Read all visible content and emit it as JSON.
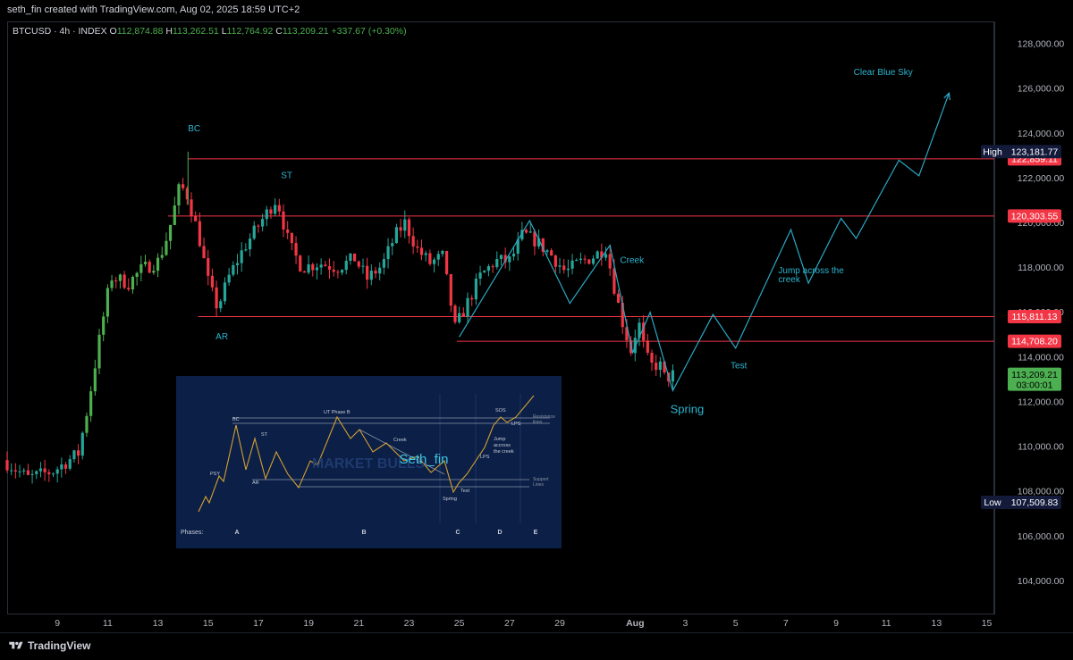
{
  "header": {
    "attribution": "seth_fin created with TradingView.com, Aug 02, 2025 18:59 UTC+2"
  },
  "legend": {
    "symbol": "BTCUSD · 4h · INDEX",
    "open_label": "O",
    "open": "112,874.88",
    "high_label": "H",
    "high": "113,262.51",
    "low_label": "L",
    "low": "112,764.92",
    "close_label": "C",
    "close": "113,209.21",
    "change": "+337.67 (+0.30%)"
  },
  "footer": {
    "brand": "TradingView"
  },
  "colors": {
    "up": "#26a69a",
    "up_bright": "#4caf50",
    "down": "#f23645",
    "level_line": "#f23645",
    "projection": "#2aa8c4",
    "annotation": "#2bb5d0"
  },
  "chart_data": {
    "type": "candlestick",
    "symbol": "BTCUSD",
    "timeframe": "4h",
    "ylim": [
      102500,
      129000
    ],
    "y_ticks": [
      "104,000.00",
      "106,000.00",
      "108,000.00",
      "110,000.00",
      "112,000.00",
      "114,000.00",
      "116,000.00",
      "118,000.00",
      "120,000.00",
      "122,000.00",
      "124,000.00",
      "126,000.00",
      "128,000.00"
    ],
    "x_ticks": [
      "9",
      "11",
      "13",
      "15",
      "17",
      "19",
      "21",
      "23",
      "25",
      "27",
      "29",
      "Aug",
      "3",
      "5",
      "7",
      "9",
      "11",
      "13",
      "15"
    ],
    "x_tick_days": [
      9,
      11,
      13,
      15,
      17,
      19,
      21,
      23,
      25,
      27,
      29,
      32,
      34,
      36,
      38,
      40,
      42,
      44,
      46
    ],
    "x_range_days": [
      7.0,
      46.3
    ],
    "horizontal_levels": [
      {
        "price": 122859.11,
        "label": "122,859.11",
        "from_day": 14.2
      },
      {
        "price": 120303.55,
        "label": "120,303.55",
        "from_day": 13.4
      },
      {
        "price": 115811.13,
        "label": "115,811.13",
        "from_day": 14.6
      },
      {
        "price": 114708.2,
        "label": "114,708.20",
        "from_day": 24.9
      }
    ],
    "price_markers": [
      {
        "kind": "High",
        "price": 123181.77,
        "label": "123,181.77"
      },
      {
        "kind": "Low",
        "price": 107509.83,
        "label": "107,509.83"
      },
      {
        "kind": "Last",
        "price": 113209.21,
        "label": "113,209.21",
        "countdown": "03:00:01"
      }
    ],
    "annotations": [
      {
        "text": "BC",
        "day": 14.2,
        "price": 124100
      },
      {
        "text": "ST",
        "day": 17.9,
        "price": 122000
      },
      {
        "text": "AR",
        "day": 15.3,
        "price": 114800
      },
      {
        "text": "Creek",
        "day": 31.4,
        "price": 118200
      },
      {
        "text": "Jump across the",
        "day": 37.7,
        "price": 117750
      },
      {
        "text": "creek",
        "day": 37.7,
        "price": 117350
      },
      {
        "text": "Test",
        "day": 35.8,
        "price": 113500
      },
      {
        "text": "Spring",
        "day": 33.4,
        "price": 111500
      },
      {
        "text": "Clear Blue Sky",
        "day": 40.7,
        "price": 126600
      }
    ],
    "projection_path": [
      [
        25.0,
        114900
      ],
      [
        27.8,
        120100
      ],
      [
        29.4,
        116400
      ],
      [
        31.0,
        119000
      ],
      [
        31.9,
        114200
      ],
      [
        32.6,
        116000
      ],
      [
        33.5,
        112500
      ],
      [
        35.1,
        115900
      ],
      [
        36.0,
        114400
      ],
      [
        38.2,
        119700
      ],
      [
        38.9,
        117300
      ],
      [
        40.2,
        120200
      ],
      [
        40.8,
        119300
      ],
      [
        42.5,
        122800
      ],
      [
        43.3,
        122100
      ],
      [
        44.5,
        125800
      ]
    ],
    "wyckoff_inset": {
      "title": "Seth_fin",
      "watermark": "MARKET BULLS",
      "labels": [
        "PSY",
        "BC",
        "ST",
        "AR",
        "UT Phase B",
        "Creek",
        "SOS",
        "LPS",
        "LPS",
        "Spring",
        "Test",
        "Jump across the creek",
        "Resistance lines",
        "Support Lines"
      ],
      "phases_label": "Phases:",
      "phases": [
        "A",
        "B",
        "C",
        "D",
        "E"
      ]
    }
  }
}
